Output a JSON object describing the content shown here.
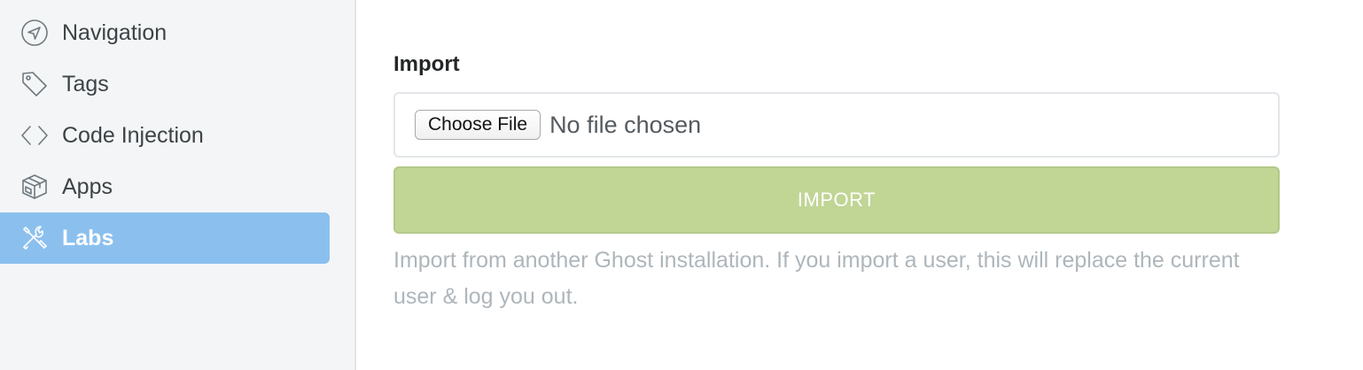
{
  "sidebar": {
    "items": [
      {
        "label": "Navigation",
        "icon": "navigation-arrow-icon",
        "active": false
      },
      {
        "label": "Tags",
        "icon": "tag-icon",
        "active": false
      },
      {
        "label": "Code Injection",
        "icon": "code-brackets-icon",
        "active": false
      },
      {
        "label": "Apps",
        "icon": "box-icon",
        "active": false
      },
      {
        "label": "Labs",
        "icon": "tools-icon",
        "active": true
      }
    ],
    "active_color": "#8bc0ee"
  },
  "import_section": {
    "title": "Import",
    "choose_file_label": "Choose File",
    "file_status": "No file chosen",
    "import_button_label": "IMPORT",
    "import_button_color": "#c1d595",
    "help_text": "Import from another Ghost installation. If you import a user, this will replace the current user & log you out."
  }
}
